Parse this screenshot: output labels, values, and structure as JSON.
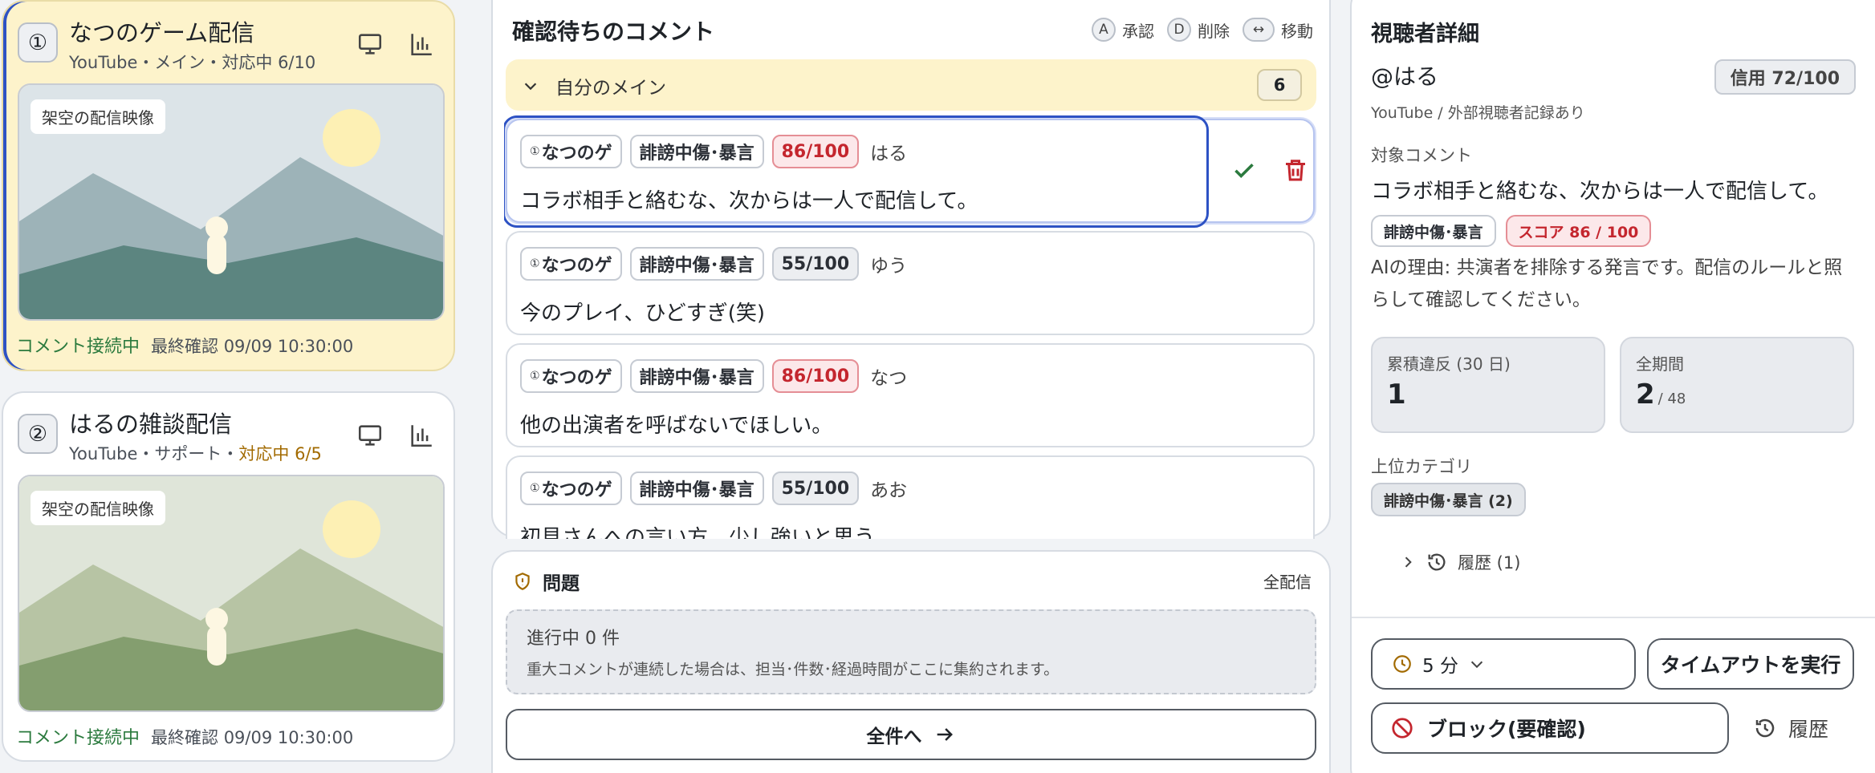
{
  "streams": [
    {
      "num": "①",
      "title": "なつのゲーム配信",
      "sub_main": "YouTube・メイン・対応中 6/10",
      "sub_warn": "",
      "preview_label": "架空の配信映像",
      "status": "コメント接続中",
      "last_check": "最終確認 09/09 10:30:00",
      "palette": {
        "sky": "#dce4e8",
        "far": "#9db3b8",
        "near": "#5c8580",
        "sun": "#fdf0b4"
      }
    },
    {
      "num": "②",
      "title": "はるの雑談配信",
      "sub_main": "YouTube・サポート・",
      "sub_warn": "対応中 6/5",
      "preview_label": "架空の配信映像",
      "status": "コメント接続中",
      "last_check": "最終確認 09/09 10:30:00",
      "palette": {
        "sky": "#dfe5d9",
        "far": "#b7c4a4",
        "near": "#849e6f",
        "sun": "#fdf0b4"
      }
    }
  ],
  "queue": {
    "title": "確認待ちのコメント",
    "legend": [
      {
        "key": "A",
        "label": "承認"
      },
      {
        "key": "D",
        "label": "削除"
      },
      {
        "key": "↔",
        "label": "移動"
      }
    ],
    "group_label": "自分のメイン",
    "group_count": "6",
    "comments": [
      {
        "stream": "なつのゲ",
        "stream_num": "①",
        "category": "誹謗中傷･暴言",
        "score": "86/100",
        "severity": "high",
        "user": "はる",
        "text": "コラボ相手と絡むな、次からは一人で配信して。"
      },
      {
        "stream": "なつのゲ",
        "stream_num": "①",
        "category": "誹謗中傷･暴言",
        "score": "55/100",
        "severity": "mid",
        "user": "ゆう",
        "text": "今のプレイ、ひどすぎ(笑)"
      },
      {
        "stream": "なつのゲ",
        "stream_num": "①",
        "category": "誹謗中傷･暴言",
        "score": "86/100",
        "severity": "high",
        "user": "なつ",
        "text": "他の出演者を呼ばないでほしい。"
      },
      {
        "stream": "なつのゲ",
        "stream_num": "①",
        "category": "誹謗中傷･暴言",
        "score": "55/100",
        "severity": "mid",
        "user": "あお",
        "text": "初見さんへの言い方、少し強いと思う。"
      }
    ]
  },
  "issues": {
    "title": "問題",
    "scope": "全配信",
    "box_heading": "進行中 0 件",
    "box_desc": "重大コメントが連続した場合は、担当･件数･経過時間がここに集約されます。",
    "all_button": "全件へ"
  },
  "viewer": {
    "title": "視聴者詳細",
    "handle": "@はる",
    "trust": "信用 72/100",
    "source": "YouTube / 外部視聴者記録あり",
    "target_label": "対象コメント",
    "target_text": "コラボ相手と絡むな、次からは一人で配信して。",
    "target_category": "誹謗中傷･暴言",
    "target_score": "スコア 86 / 100",
    "reason": "AIの理由: 共演者を排除する発言です。配信のルールと照らして確認してください。",
    "stat1_label": "累積違反 (30 日)",
    "stat1_value": "1",
    "stat2_label": "全期間",
    "stat2_value": "2",
    "stat2_total": "/ 48",
    "top_cat_label": "上位カテゴリ",
    "top_cat": "誹謗中傷･暴言 (2)",
    "history_toggle": "履歴 (1)",
    "timeout_duration": "5 分",
    "timeout_button": "タイムアウトを実行",
    "block_button": "ブロック(要確認)",
    "history_button": "履歴"
  },
  "colors": {
    "accent": "#2d52c4",
    "danger": "#c4262e",
    "ok": "#2b7a3e",
    "warn": "#a26a00",
    "highlight": "#fdf3cb"
  }
}
